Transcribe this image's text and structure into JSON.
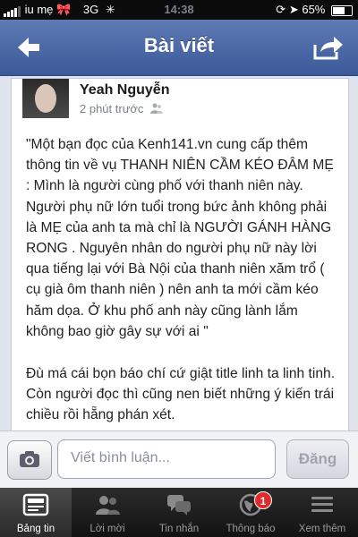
{
  "status_bar": {
    "carrier": "iu mẹ",
    "network": "3G",
    "time": "14:38",
    "battery": "65%"
  },
  "navbar": {
    "title": "Bài viết"
  },
  "post": {
    "author": "Yeah Nguyễn",
    "time": "2 phút trước",
    "paragraph_1": "\"Một bạn đọc của Kenh141.vn cung cấp thêm thông tin về vụ THANH NIÊN CẦM KÉO ĐÂM MẸ : Mình là người cùng phố với thanh niên này. Người phụ nữ lớn tuổi trong bức ảnh không phải là MẸ của anh ta mà chỉ là NGƯỜI GÁNH HÀNG RONG . Nguyên nhân do người phụ nữ này lời qua tiếng lại với Bà Nội của thanh niên xăm trổ ( cụ già ôm thanh niên ) nên anh ta mới cầm kéo hăm dọa. Ở khu phố anh này cũng lành lắm không bao giờ gây sự với ai \"",
    "paragraph_2": "Đù má cái bọn báo chí cứ giật title linh ta linh tinh. Còn người đọc thì cũng nen biết những ý kiến trái chiều rồi hẵng phán xét."
  },
  "composer": {
    "placeholder": "Viết bình luận...",
    "send_label": "Đăng"
  },
  "tabbar": {
    "tabs": [
      {
        "label": "Bảng tin",
        "icon": "news-feed-icon",
        "active": true
      },
      {
        "label": "Lời mời",
        "icon": "friend-requests-icon"
      },
      {
        "label": "Tin nhắn",
        "icon": "messages-icon"
      },
      {
        "label": "Thông báo",
        "icon": "notifications-globe-icon",
        "badge": "1"
      },
      {
        "label": "Xem thêm",
        "icon": "more-menu-icon"
      }
    ]
  },
  "colors": {
    "brand": "#3b5998",
    "badge": "#e02b2b"
  }
}
